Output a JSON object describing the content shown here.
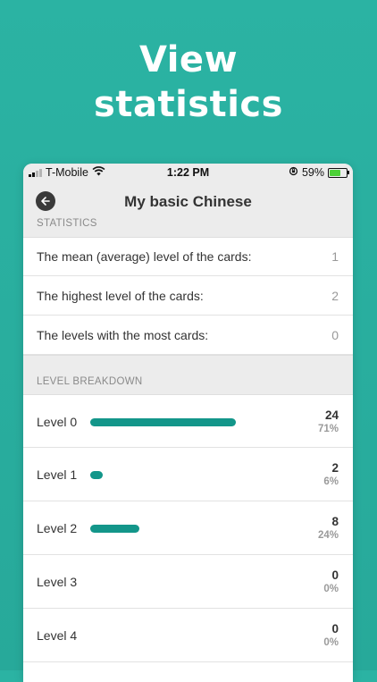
{
  "hero": {
    "line1": "View",
    "line2": "statistics"
  },
  "status_bar": {
    "carrier": "T-Mobile",
    "time": "1:22 PM",
    "battery": "59%",
    "battery_level": 0.59
  },
  "nav": {
    "title": "My basic Chinese"
  },
  "sections": {
    "statistics": "STATISTICS",
    "breakdown": "LEVEL BREAKDOWN"
  },
  "stats": [
    {
      "label": "The mean (average) level of the cards:",
      "value": "1"
    },
    {
      "label": "The highest level of the cards:",
      "value": "2"
    },
    {
      "label": "The levels with the most cards:",
      "value": "0"
    }
  ],
  "levels": [
    {
      "label": "Level 0",
      "count": "24",
      "percent": "71%",
      "fraction": 0.71
    },
    {
      "label": "Level 1",
      "count": "2",
      "percent": "6%",
      "fraction": 0.06
    },
    {
      "label": "Level 2",
      "count": "8",
      "percent": "24%",
      "fraction": 0.24
    },
    {
      "label": "Level 3",
      "count": "0",
      "percent": "0%",
      "fraction": 0
    },
    {
      "label": "Level 4",
      "count": "0",
      "percent": "0%",
      "fraction": 0
    }
  ],
  "colors": {
    "background": "#2bb3a3",
    "bar": "#13968a"
  },
  "icons": {
    "back": "back-arrow-icon",
    "wifi": "wifi-icon",
    "signal": "signal-icon",
    "orientation_lock": "orientation-lock-icon",
    "battery": "battery-charging-icon"
  }
}
